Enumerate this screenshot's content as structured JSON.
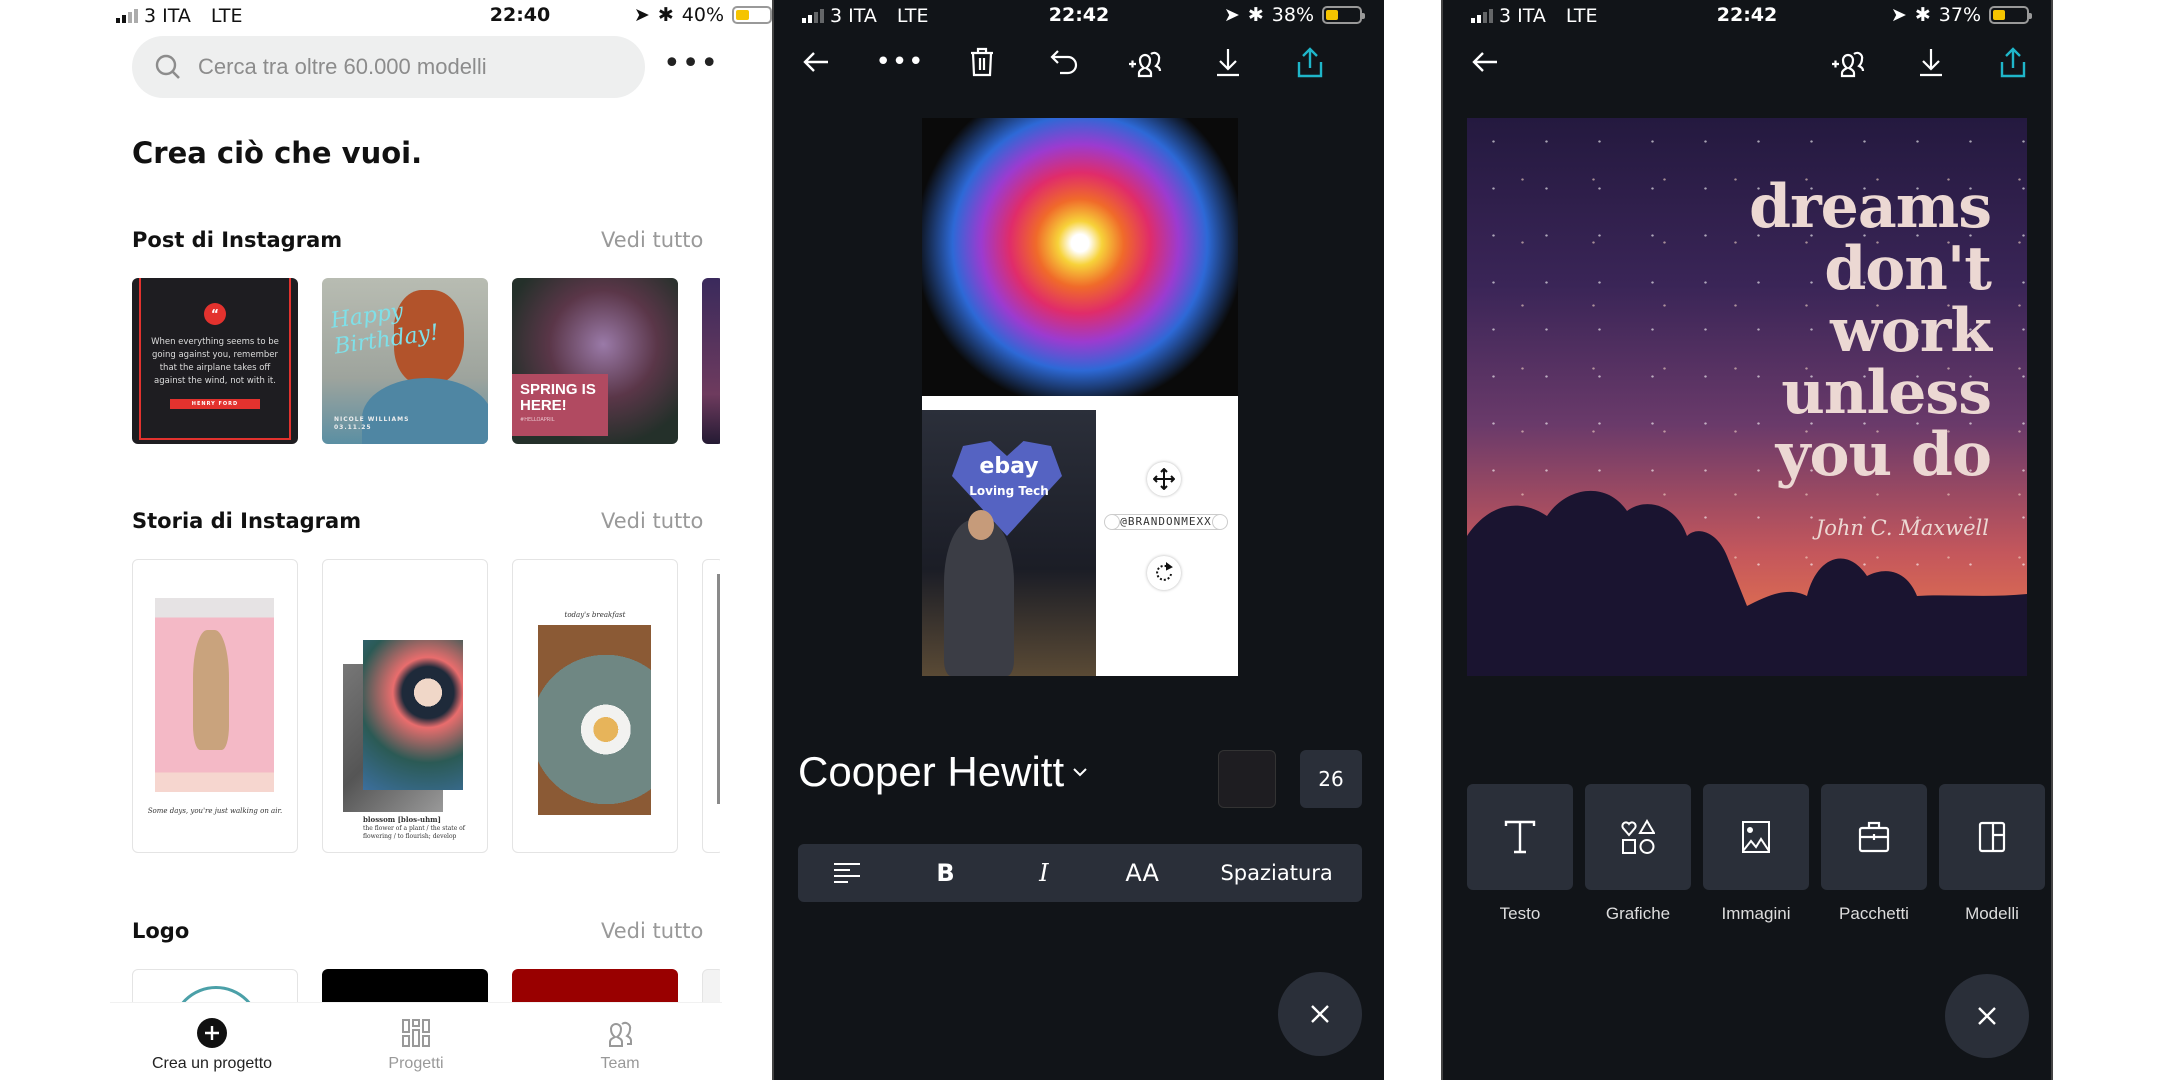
{
  "left": {
    "status": {
      "carrier": "3 ITA",
      "network": "LTE",
      "time": "22:40",
      "battery": "40%",
      "battery_level": 0.4
    },
    "search": {
      "placeholder": "Cerca tra oltre 60.000 modelli"
    },
    "more_icon": "more-horizontal-icon",
    "headline": "Crea ciò che vuoi.",
    "sections": [
      {
        "title": "Post di Instagram",
        "see_all": "Vedi tutto"
      },
      {
        "title": "Storia di Instagram",
        "see_all": "Vedi tutto"
      },
      {
        "title": "Logo",
        "see_all": "Vedi tutto"
      }
    ],
    "posts": [
      {
        "quote": "When everything seems to be going against you, remember that the airplane takes off against the wind, not with it.",
        "author": "HENRY FORD"
      },
      {
        "title": "Happy Birthday!",
        "name": "NICOLE WILLIAMS",
        "date": "03.11.25"
      },
      {
        "title": "SPRING IS HERE!",
        "tag": "#HELLOAPRIL"
      }
    ],
    "stories": [
      {
        "caption": "Some days, you're just walking on air."
      },
      {
        "title": "blossom [blos-uhm]",
        "lines": "the flower of a plant / the state of flowering / to flourish; develop"
      },
      {
        "caption": "today's breakfast"
      }
    ],
    "tabbar": [
      {
        "label": "Crea un progetto",
        "icon": "plus-circle-icon",
        "active": true
      },
      {
        "label": "Progetti",
        "icon": "grid-icon",
        "active": false
      },
      {
        "label": "Team",
        "icon": "team-icon",
        "active": false
      }
    ]
  },
  "middle": {
    "status": {
      "carrier": "3 ITA",
      "network": "LTE",
      "time": "22:42",
      "battery": "38%",
      "battery_level": 0.38
    },
    "toolbar": [
      "back-arrow-icon",
      "more-horizontal-icon",
      "trash-icon",
      "undo-icon",
      "add-team-icon",
      "download-icon",
      "share-icon"
    ],
    "design": {
      "ebay_logo": "ebay",
      "ebay_tagline": "Loving Tech",
      "handle_text": "@BRANDONMEXX"
    },
    "font_name": "Cooper Hewitt",
    "font_size": "26",
    "text_color": "#1e1d21",
    "format_bar": {
      "align": "align-left-icon",
      "bold": "B",
      "italic": "I",
      "case": "AA",
      "spacing": "Spaziatura"
    },
    "accent": "#1fb6c9"
  },
  "right": {
    "status": {
      "carrier": "3 ITA",
      "network": "LTE",
      "time": "22:42",
      "battery": "37%",
      "battery_level": 0.37
    },
    "quote_lines": [
      "dreams",
      "don't",
      "work",
      "unless",
      "you do"
    ],
    "author": "John C. Maxwell",
    "tools": [
      {
        "label": "Testo",
        "icon": "text-icon"
      },
      {
        "label": "Grafiche",
        "icon": "shapes-icon"
      },
      {
        "label": "Immagini",
        "icon": "image-icon"
      },
      {
        "label": "Pacchetti",
        "icon": "briefcase-icon"
      },
      {
        "label": "Modelli",
        "icon": "layout-icon"
      }
    ]
  }
}
